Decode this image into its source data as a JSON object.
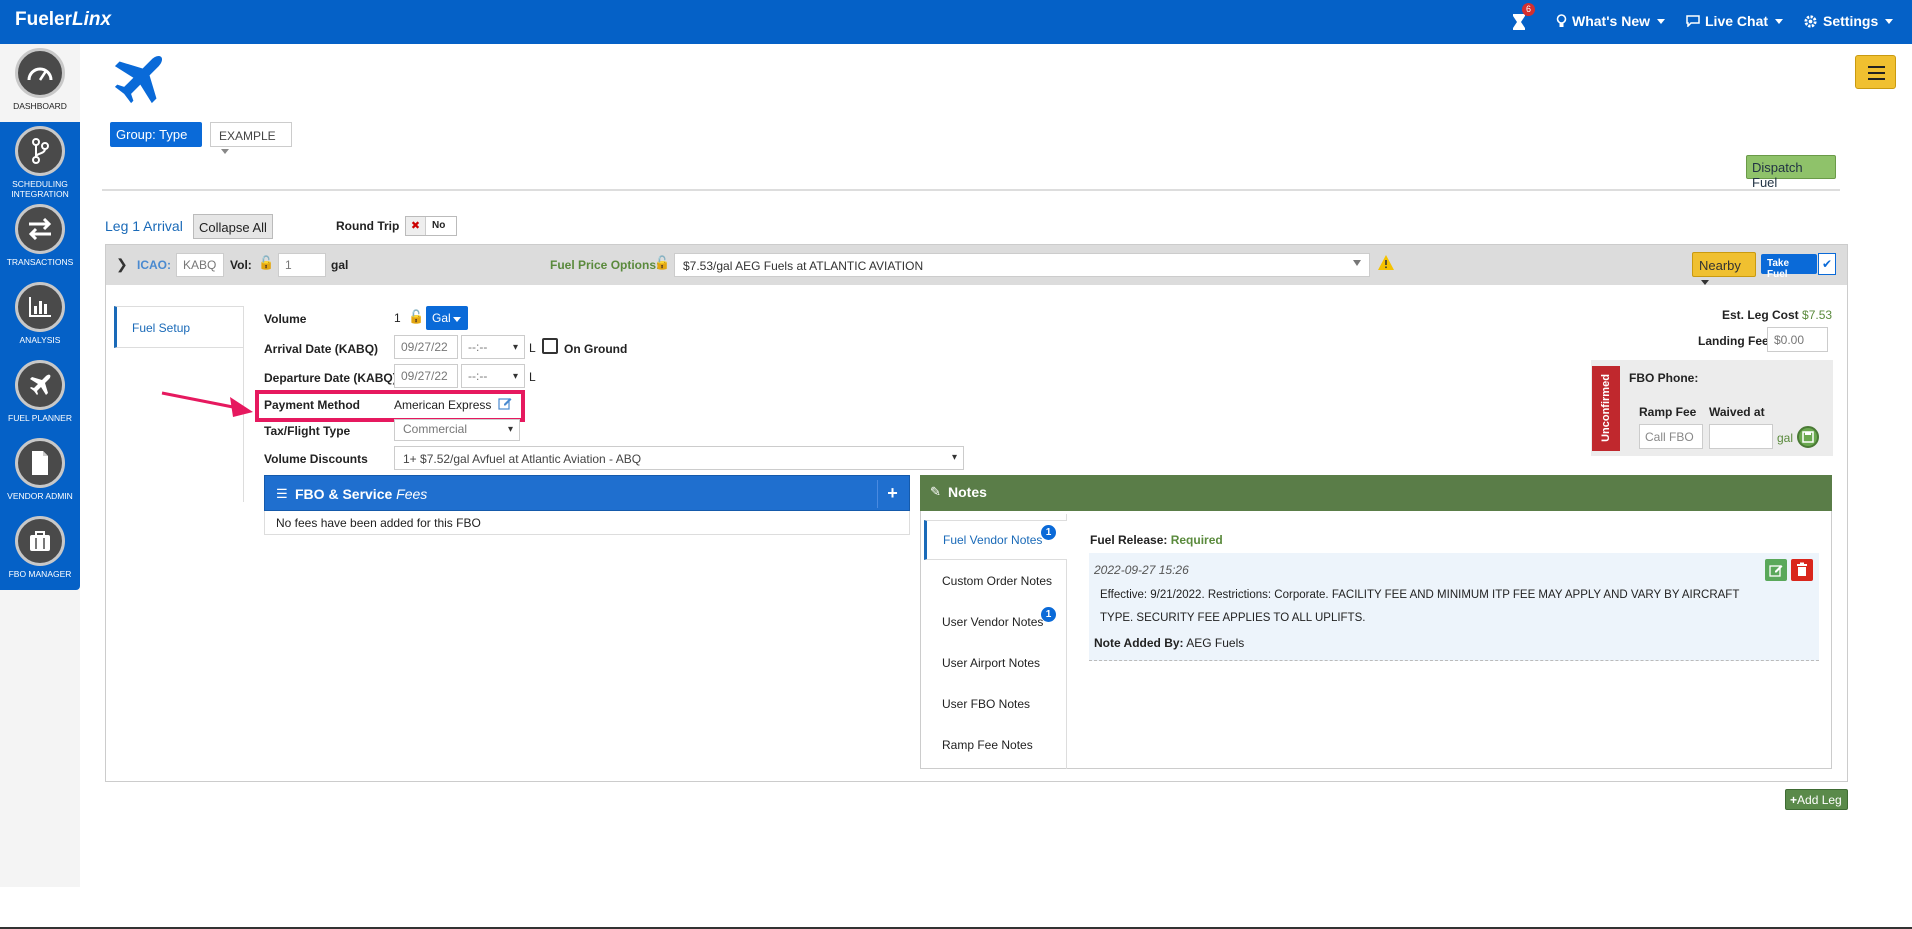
{
  "app": {
    "logo_plain": "Fueler",
    "logo_italic": "Linx"
  },
  "topnav": {
    "notif_count": "6",
    "whats_new": "What's New",
    "live_chat": "Live Chat",
    "settings": "Settings"
  },
  "sidebar": {
    "items": [
      {
        "label": "DASHBOARD",
        "icon": "gauge-icon"
      },
      {
        "label": "SCHEDULING INTEGRATION",
        "icon": "branch-icon"
      },
      {
        "label": "TRANSACTIONS",
        "icon": "swap-icon"
      },
      {
        "label": "ANALYSIS",
        "icon": "bar-chart-icon"
      },
      {
        "label": "FUEL PLANNER",
        "icon": "plane-icon"
      },
      {
        "label": "VENDOR ADMIN",
        "icon": "document-icon"
      },
      {
        "label": "FBO MANAGER",
        "icon": "briefcase-icon"
      }
    ]
  },
  "toolbar": {
    "group_type": "Group: Type",
    "example": "EXAMPLE",
    "dispatch_fuel": "Dispatch Fuel"
  },
  "leg": {
    "title": "Leg 1 Arrival",
    "collapse_all": "Collapse All",
    "round_trip_label": "Round Trip",
    "round_trip_value": "No",
    "icao_label": "ICAO:",
    "icao_value": "KABQ",
    "vol_label": "Vol:",
    "vol_value": "1",
    "vol_unit": "gal",
    "fuel_price_label": "Fuel Price Options:",
    "fuel_price_value_prefix": "$7.53/gal",
    "fuel_price_vendor": "AEG Fuels",
    "fuel_price_at": "at",
    "fuel_price_fbo": "ATLANTIC AVIATION",
    "nearby": "Nearby",
    "take_fuel": "Take Fuel"
  },
  "setup": {
    "tab": "Fuel Setup",
    "volume_label": "Volume",
    "volume_value": "1",
    "volume_unit": "Gal",
    "arrival_label": "Arrival Date (KABQ)",
    "arrival_date": "09/27/22",
    "arrival_time": "--:--",
    "arrival_suffix": "L",
    "on_ground": "On Ground",
    "departure_label": "Departure Date (KABQ)",
    "departure_date": "09/27/22",
    "departure_time": "--:--",
    "departure_suffix": "L",
    "payment_label": "Payment Method",
    "payment_value": "American Express",
    "tax_label": "Tax/Flight Type",
    "tax_value": "Commercial",
    "discounts_label": "Volume Discounts",
    "discounts_value": "1+ $7.52/gal Avfuel at Atlantic Aviation - ABQ"
  },
  "cost": {
    "est_label": "Est. Leg Cost",
    "est_value": "$7.53",
    "landing_label": "Landing Fee",
    "landing_placeholder": "$0.00",
    "unconfirmed": "Unconfirmed",
    "fbo_phone": "FBO Phone:",
    "ramp_fee": "Ramp Fee",
    "waived_at": "Waived at",
    "ramp_placeholder": "Call FBO",
    "waived_unit": "gal"
  },
  "fees": {
    "title": "FBO & Service",
    "title_italic": "Fees",
    "empty": "No fees have been added for this FBO"
  },
  "notes": {
    "title": "Notes",
    "tabs": [
      {
        "label": "Fuel Vendor Notes",
        "count": "1"
      },
      {
        "label": "Custom Order Notes",
        "count": ""
      },
      {
        "label": "User Vendor Notes",
        "count": "1"
      },
      {
        "label": "User Airport Notes",
        "count": ""
      },
      {
        "label": "User FBO Notes",
        "count": ""
      },
      {
        "label": "Ramp Fee Notes",
        "count": ""
      }
    ],
    "fuel_release_label": "Fuel Release:",
    "fuel_release_value": "Required",
    "entry_date": "2022-09-27 15:26",
    "entry_text_1": "Effective: 9/21/2022. Restrictions: Corporate. FACILITY FEE AND MINIMUM ITP FEE MAY APPLY AND VARY BY AIRCRAFT",
    "entry_text_2": "TYPE. SECURITY FEE APPLIES TO ALL UPLIFTS.",
    "added_by_label": "Note Added By:",
    "added_by_value": "AEG Fuels"
  },
  "add_leg": "Add Leg",
  "colors": {
    "brand_blue": "#0561c7",
    "notes_green": "#5a7d48",
    "annotation_pink": "#e6195f",
    "warning_yellow": "#f0c030"
  }
}
